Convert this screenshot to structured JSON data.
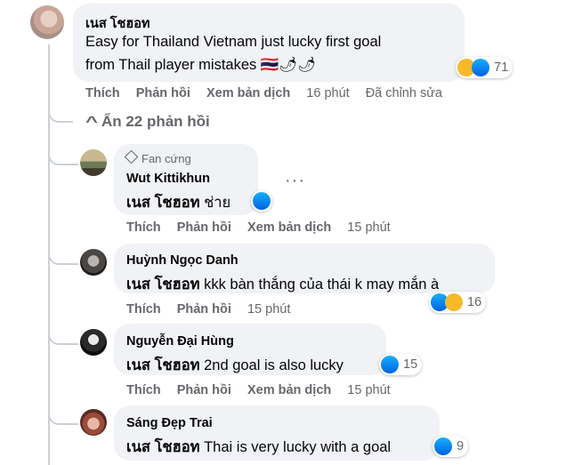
{
  "main_comment": {
    "author": "เนส โชฮอท",
    "text_line1": "Easy for Thailand Vietnam just lucky first goal",
    "text_line2": "from Thail player mistakes 🇹🇭🌶🌶",
    "reaction_count": "71",
    "actions": {
      "like": "Thích",
      "reply": "Phản hồi",
      "translate": "Xem bản dịch",
      "time": "16 phút",
      "edited": "Đã chỉnh sửa"
    }
  },
  "hide_replies": {
    "chevron": "^",
    "label": "Ẩn 22 phản hồi"
  },
  "replies": [
    {
      "badge": "Fan cứng",
      "author": "Wut Kittikhun",
      "tag": "เนส โชฮอท",
      "text": "ช่าย",
      "actions": {
        "like": "Thích",
        "reply": "Phản hồi",
        "translate": "Xem bản dịch",
        "time": "15 phút"
      },
      "more": "···"
    },
    {
      "author": "Huỳnh Ngọc Danh",
      "tag": "เนส โชฮอท",
      "text": "kkk bàn thắng của thái k may mắn à",
      "reaction_count": "16",
      "actions": {
        "like": "Thích",
        "reply": "Phản hồi",
        "time": "15 phút"
      }
    },
    {
      "author": "Nguyễn Đại Hùng",
      "tag": "เนส โชฮอท",
      "text": "2nd goal is also lucky",
      "reaction_count": "15",
      "actions": {
        "like": "Thích",
        "reply": "Phản hồi",
        "translate": "Xem bản dịch",
        "time": "15 phút"
      }
    },
    {
      "author": "Sáng Đẹp Trai",
      "tag": "เนส โชฮอท",
      "text": "Thai is very lucky with a goal",
      "reaction_count": "9"
    }
  ]
}
